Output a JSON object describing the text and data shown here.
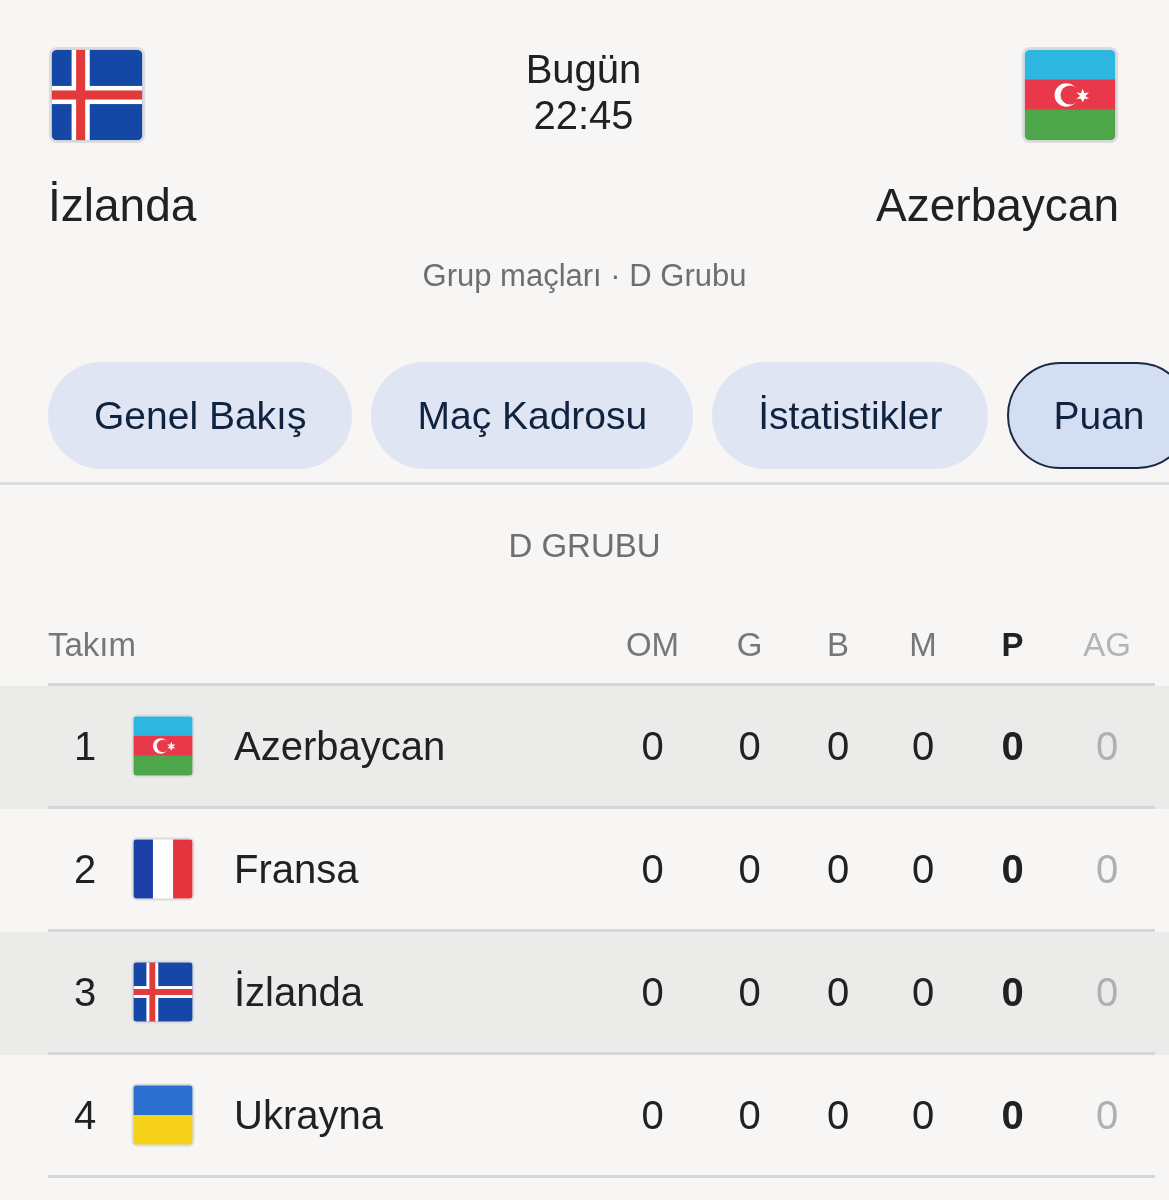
{
  "match": {
    "home": {
      "name": "İzlanda",
      "flag": {
        "kind": "iceland"
      }
    },
    "day": "Bugün",
    "time": "22:45",
    "away": {
      "name": "Azerbaycan",
      "flag": {
        "kind": "azerbaijan"
      }
    },
    "stage": "Grup maçları · D Grubu"
  },
  "tabs": [
    {
      "label": "Genel Bakış",
      "selected": false
    },
    {
      "label": "Maç Kadrosu",
      "selected": false
    },
    {
      "label": "İstatistikler",
      "selected": false
    },
    {
      "label": "Puan",
      "selected": true
    }
  ],
  "standings": {
    "title": "D GRUBU",
    "columns": [
      {
        "label": "Takım",
        "kind": "team"
      },
      {
        "label": "OM",
        "kind": "normal"
      },
      {
        "label": "G",
        "kind": "normal"
      },
      {
        "label": "B",
        "kind": "normal"
      },
      {
        "label": "M",
        "kind": "normal"
      },
      {
        "label": "P",
        "kind": "bold"
      },
      {
        "label": "AG",
        "kind": "faded"
      }
    ],
    "rows": [
      {
        "rank": "1",
        "flag": {
          "kind": "azerbaijan"
        },
        "team": "Azerbaycan",
        "highlighted": true,
        "values": [
          "0",
          "0",
          "0",
          "0",
          "0",
          "0"
        ]
      },
      {
        "rank": "2",
        "flag": {
          "kind": "france"
        },
        "team": "Fransa",
        "highlighted": false,
        "values": [
          "0",
          "0",
          "0",
          "0",
          "0",
          "0"
        ]
      },
      {
        "rank": "3",
        "flag": {
          "kind": "iceland"
        },
        "team": "İzlanda",
        "highlighted": true,
        "values": [
          "0",
          "0",
          "0",
          "0",
          "0",
          "0"
        ]
      },
      {
        "rank": "4",
        "flag": {
          "kind": "ukraine"
        },
        "team": "Ukrayna",
        "highlighted": false,
        "values": [
          "0",
          "0",
          "0",
          "0",
          "0",
          "0"
        ]
      }
    ]
  }
}
